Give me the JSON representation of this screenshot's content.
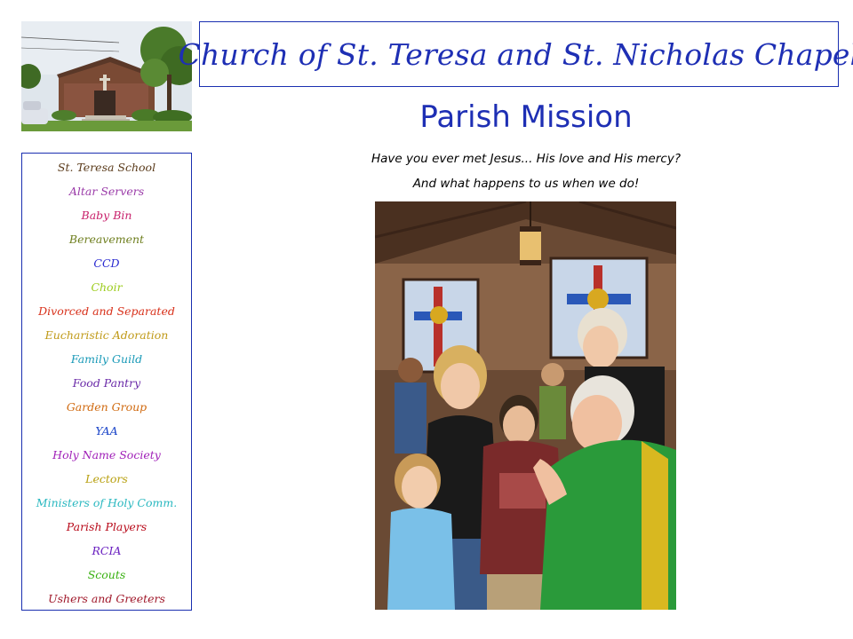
{
  "header": {
    "title": "Church of St. Teresa and St. Nicholas Chapel"
  },
  "sidebar": {
    "items": [
      {
        "label": "St. Teresa School",
        "color": "#5a3a1a"
      },
      {
        "label": "Altar Servers",
        "color": "#9a3aa8"
      },
      {
        "label": "Baby Bin",
        "color": "#c8226c"
      },
      {
        "label": "Bereavement",
        "color": "#6f7f1f"
      },
      {
        "label": "CCD",
        "color": "#2a2ad0"
      },
      {
        "label": "Choir",
        "color": "#9ccc1c"
      },
      {
        "label": "Divorced and Separated",
        "color": "#d8301a"
      },
      {
        "label": "Eucharistic Adoration",
        "color": "#c09a18"
      },
      {
        "label": "Family Guild",
        "color": "#1a9ab8"
      },
      {
        "label": "Food Pantry",
        "color": "#6a2aa8"
      },
      {
        "label": "Garden Group",
        "color": "#d06a10"
      },
      {
        "label": "YAA",
        "color": "#1a44c8"
      },
      {
        "label": "Holy Name Society",
        "color": "#a020b8"
      },
      {
        "label": "Lectors",
        "color": "#b8a010"
      },
      {
        "label": "Ministers of Holy Comm.",
        "color": "#2ab8c0"
      },
      {
        "label": "Parish Players",
        "color": "#b80a1a"
      },
      {
        "label": "RCIA",
        "color": "#6a20c0"
      },
      {
        "label": "Scouts",
        "color": "#38b010"
      },
      {
        "label": "Ushers and Greeters",
        "color": "#a0182a"
      }
    ]
  },
  "main": {
    "heading": "Parish Mission",
    "tagline_1": "Have you ever met Jesus... His love and His mercy?",
    "tagline_2": "And what happens to us when we do!"
  },
  "colors": {
    "accent": "#1e2fb4",
    "border": "#1a2fb0"
  }
}
